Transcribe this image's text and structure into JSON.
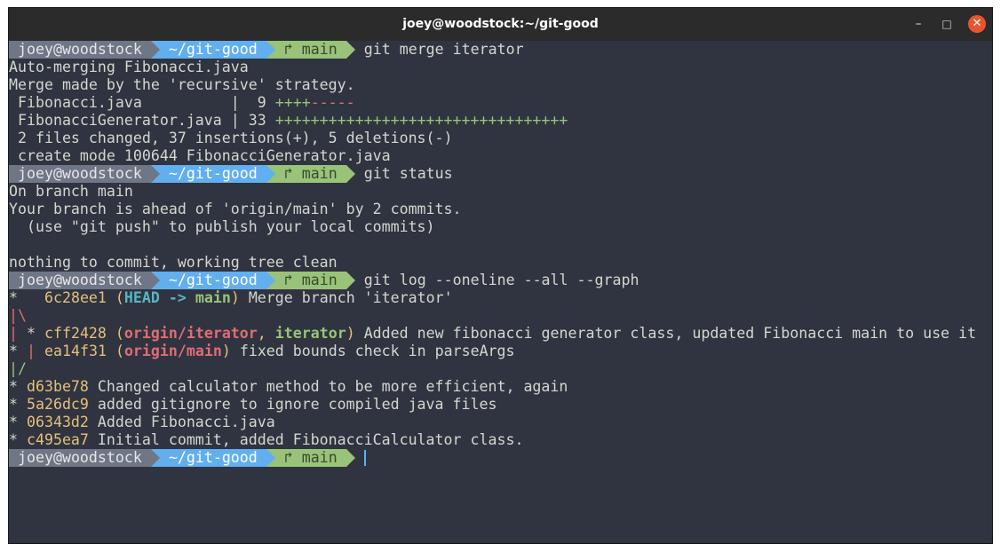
{
  "window": {
    "title": "joey@woodstock:~/git-good",
    "minimize": "–",
    "maximize": "□",
    "close": "✕"
  },
  "prompt": {
    "user": "joey@woodstock",
    "dir": "~/git-good",
    "branch_icon": "↱",
    "branch": "main"
  },
  "commands": {
    "c1": "git merge iterator",
    "c2": "git status",
    "c3": "git log --oneline --all --graph"
  },
  "merge": {
    "l1": "Auto-merging Fibonacci.java",
    "l2": "Merge made by the 'recursive' strategy.",
    "f1_name": " Fibonacci.java          |  9 ",
    "f1_plus": "++++",
    "f1_minus": "-----",
    "f2_name": " FibonacciGenerator.java | 33 ",
    "f2_plus": "+++++++++++++++++++++++++++++++++",
    "summary": " 2 files changed, 37 insertions(+), 5 deletions(-)",
    "create": " create mode 100644 FibonacciGenerator.java"
  },
  "status": {
    "l1": "On branch main",
    "l2": "Your branch is ahead of 'origin/main' by 2 commits.",
    "l3": "  (use \"git push\" to publish your local commits)",
    "l4": "nothing to commit, working tree clean"
  },
  "log": {
    "r1_star": "*",
    "r1_hash": "6c28ee1",
    "r1_open": "(",
    "r1_head": "HEAD -> ",
    "r1_main": "main",
    "r1_close": ")",
    "r1_msg": " Merge branch 'iterator'",
    "r2_bar": "|",
    "r2_slash": "\\",
    "r3_bar": "|",
    "r3_star": " *",
    "r3_hash": "cff2428",
    "r3_open": "(",
    "r3_ref1": "origin/iterator",
    "r3_sep": ", ",
    "r3_ref2": "iterator",
    "r3_close": ")",
    "r3_msg": " Added new fibonacci generator class, updated Fibonacci main to use it",
    "r4_star": "*",
    "r4_bar": "|",
    "r4_hash": "ea14f31",
    "r4_open": "(",
    "r4_ref": "origin/main",
    "r4_close": ")",
    "r4_msg": " fixed bounds check in parseArgs",
    "r5_slash": "|/",
    "commits": [
      {
        "hash": "d63be78",
        "msg": " Changed calculator method to be more efficient, again"
      },
      {
        "hash": "5a26dc9",
        "msg": " added gitignore to ignore compiled java files"
      },
      {
        "hash": "06343d2",
        "msg": " Added Fibonacci.java"
      },
      {
        "hash": "c495ea7",
        "msg": " Initial commit, added FibonacciCalculator class."
      }
    ]
  },
  "colors": {
    "terminal_bg": "#303440",
    "prompt_user_bg": "#6f7686",
    "prompt_dir_bg": "#61afef",
    "prompt_branch_bg": "#98c379",
    "hash": "#e5c07b",
    "head": "#56b6c2",
    "ref_red": "#e06c75",
    "ref_green": "#98c379"
  }
}
